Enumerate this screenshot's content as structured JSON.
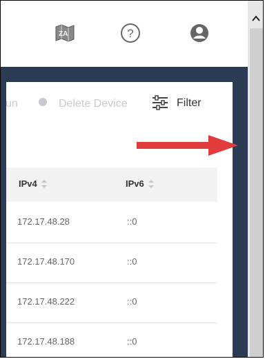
{
  "toolbar": {
    "partial_label": "un",
    "delete_label": "Delete Device",
    "filter_label": "Filter"
  },
  "table": {
    "columns": [
      "IPv4",
      "IPv6"
    ],
    "rows": [
      {
        "ipv4": "172.17.48.28",
        "ipv6": "::0"
      },
      {
        "ipv4": "172.17.48.170",
        "ipv6": "::0"
      },
      {
        "ipv4": "172.17.48.222",
        "ipv6": "::0"
      },
      {
        "ipv4": "172.17.48.188",
        "ipv6": "::0"
      }
    ]
  },
  "icons": {
    "top_left": "map-icon",
    "top_middle": "help-icon",
    "top_right": "user-icon",
    "toolbar_delete": "delete-icon",
    "toolbar_filter": "filter-icon"
  },
  "colors": {
    "panel": "#2a3b53",
    "accent_arrow": "#e23b3b"
  }
}
